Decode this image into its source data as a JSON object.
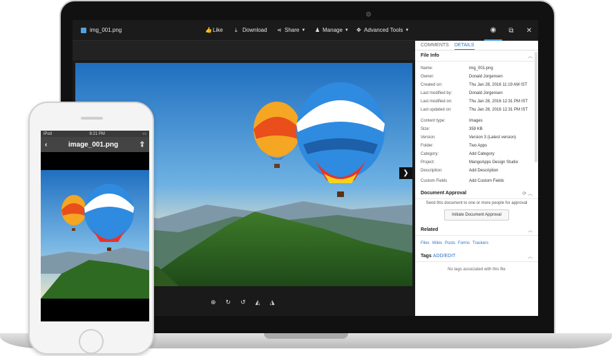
{
  "viewer": {
    "filename": "img_001.png",
    "toolbar": {
      "like": "Like",
      "download": "Download",
      "share": "Share",
      "manage": "Manage",
      "advanced_tools": "Advanced Tools"
    }
  },
  "panel": {
    "tabs": [
      "COMMENTS",
      "DETAILS"
    ],
    "active_tab": "DETAILS",
    "file_info": {
      "title": "File Info",
      "rows": [
        {
          "k": "Name:",
          "v": "img_001.png"
        },
        {
          "k": "Owner:",
          "v": "Donald Jorgensen"
        },
        {
          "k": "Created on:",
          "v": "Thu Jan 28, 2016 11:19 AM IST"
        },
        {
          "k": "Last modified by:",
          "v": "Donald Jorgensen"
        },
        {
          "k": "Last modified on:",
          "v": "Thu Jan 28, 2016 12:31 PM IST"
        },
        {
          "k": "Last updated on:",
          "v": "Thu Jan 28, 2016 12:31 PM IST"
        },
        {
          "k": "Content type:",
          "v": "Images"
        },
        {
          "k": "Size:",
          "v": "359 KB"
        },
        {
          "k": "Version:",
          "v": "Version 3 (Latest version)"
        },
        {
          "k": "Folder:",
          "v": "Two Apps"
        },
        {
          "k": "Category:",
          "v": "Add Category"
        },
        {
          "k": "Project:",
          "v": "MangoApps Design Studio"
        },
        {
          "k": "Description:",
          "v": "Add Description"
        },
        {
          "k": "Custom Fields",
          "v": "Add Custom Fields"
        }
      ]
    },
    "approval": {
      "title": "Document Approval",
      "text": "Send this document to one or more people for approval",
      "button": "Initiate Document Approval"
    },
    "related": {
      "title": "Related",
      "items": [
        "Files",
        "Wikis",
        "Posts",
        "Forms",
        "Trackers"
      ]
    },
    "tags": {
      "title": "Tags",
      "action": "ADD/EDIT",
      "empty": "No tags associated with this file"
    }
  },
  "phone": {
    "carrier": "iPod",
    "time": "8:21 PM",
    "title": "image_001.png"
  },
  "colors": {
    "accent": "#2a74c5",
    "dark_bar": "#1b1b1b"
  }
}
